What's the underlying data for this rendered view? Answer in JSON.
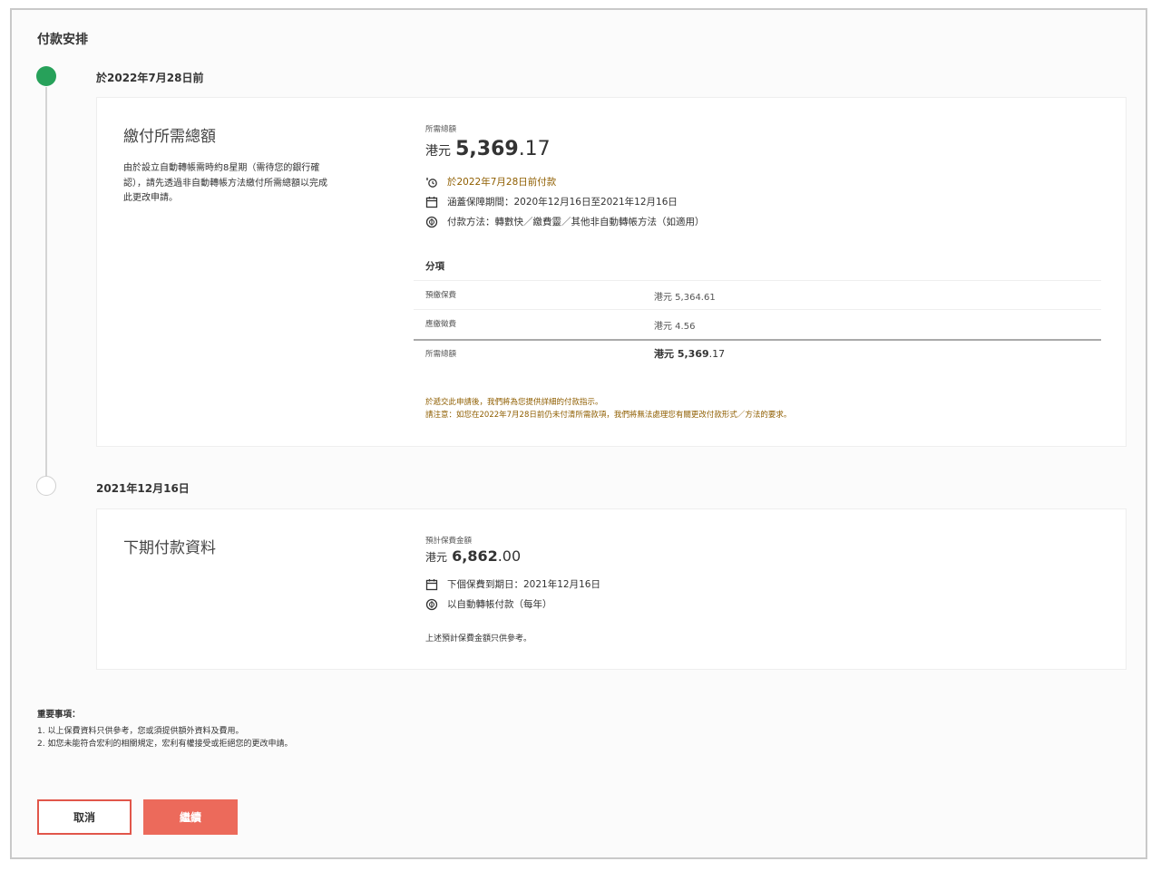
{
  "page": {
    "title": "付款安排"
  },
  "step1": {
    "date": "於2022年7月28日前",
    "card": {
      "title": "繳付所需總額",
      "description": "由於設立自動轉帳需時約8星期（需待您的銀行確認），請先透過非自動轉帳方法繳付所需總額以完成此更改申請。",
      "description_lines": [
        "由於設立自動轉帳需時約8星期（需待您的銀行確",
        "認），請先透過非自動轉帳方法繳付所需總額以完成",
        "此更改申請。"
      ],
      "amount_label": "所需總額",
      "amount_currency": "港元",
      "amount_int": "5,369",
      "amount_dec": ".17",
      "info": [
        {
          "icon": "clock-icon",
          "text": "於2022年7月28日前付款",
          "color": "#8f5e00"
        },
        {
          "icon": "calendar-icon",
          "text": "涵蓋保障期間：2020年12月16日至2021年12月16日"
        },
        {
          "icon": "payment-icon",
          "text": "付款方法：轉數快／繳費靈／其他非自動轉帳方法（如適用）"
        }
      ],
      "breakdown_title": "分項",
      "breakdown": [
        {
          "label": "預繳保費",
          "value": "港元 5,364.61"
        },
        {
          "label": "應繳徵費",
          "value": "港元 4.56"
        }
      ],
      "total": {
        "label": "所需總額",
        "value_bold": "港元 5,369",
        "value_dec": ".17"
      },
      "notes": [
        "於遞交此申請後，我們將為您提供詳細的付款指示。",
        "請注意：如您在2022年7月28日前仍未付清所需款項，我們將無法處理您有關更改付款形式／方法的要求。"
      ]
    }
  },
  "step2": {
    "date": "2021年12月16日",
    "card": {
      "title": "下期付款資料",
      "amount_label": "預計保費金額",
      "amount_currency": "港元",
      "amount_int": "6,862",
      "amount_dec": ".00",
      "info": [
        {
          "icon": "calendar-icon",
          "text": "下個保費到期日：2021年12月16日"
        },
        {
          "icon": "payment-icon",
          "text": "以自動轉帳付款（每年）"
        }
      ],
      "note": "上述預計保費金額只供參考。"
    }
  },
  "important": {
    "title": "重要事項：",
    "items": [
      "1. 以上保費資料只供參考，您或須提供額外資料及費用。",
      "2. 如您未能符合宏利的相關規定，宏利有權接受或拒絕您的更改申請。"
    ]
  },
  "buttons": {
    "cancel": "取消",
    "continue": "繼續"
  },
  "colors": {
    "accent": "#ec6a5b",
    "success": "#27a15a",
    "amber": "#8f5e00"
  }
}
